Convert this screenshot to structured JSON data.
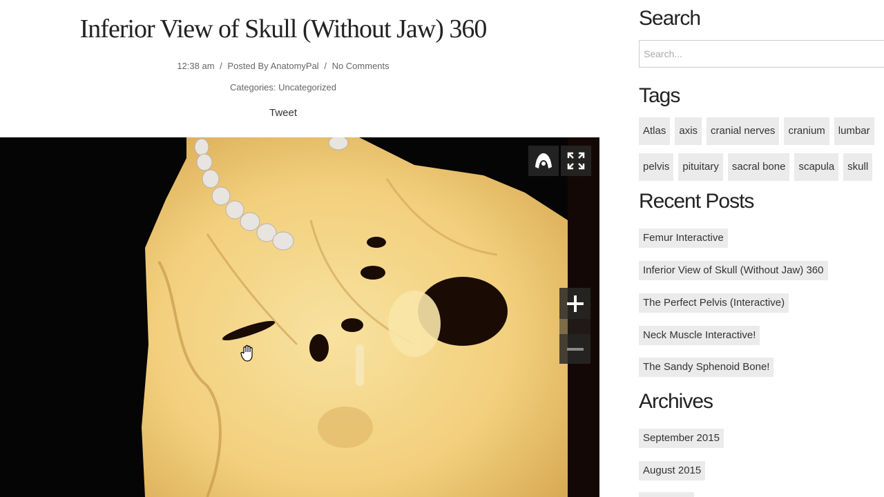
{
  "post": {
    "title": "Inferior View of Skull (Without Jaw) 360",
    "time": "12:38 am",
    "posted_by_prefix": "Posted By",
    "author": "AnatomyPal",
    "comments": "No Comments",
    "separator": "/",
    "categories_label": "Categories:",
    "category": "Uncategorized",
    "tweet_label": "Tweet"
  },
  "viewer": {
    "icons": {
      "gyro": "gyroscope-icon",
      "fullscreen": "fullscreen-icon",
      "zoom_in": "zoom-in-icon",
      "zoom_out": "zoom-out-icon",
      "cursor": "grab-hand-cursor-icon"
    }
  },
  "sidebar": {
    "search": {
      "title": "Search",
      "placeholder": "Search..."
    },
    "tags": {
      "title": "Tags",
      "row1": [
        "Atlas",
        "axis",
        "cranial nerves",
        "cranium",
        "lumbar"
      ],
      "row2": [
        "pelvis",
        "pituitary",
        "sacral bone",
        "scapula",
        "skull"
      ]
    },
    "recent_posts": {
      "title": "Recent Posts",
      "items": [
        "Femur Interactive",
        "Inferior View of Skull (Without Jaw) 360",
        "The Perfect Pelvis (Interactive)",
        "Neck Muscle Interactive!",
        "The Sandy Sphenoid Bone!"
      ]
    },
    "archives": {
      "title": "Archives",
      "items": [
        "September 2015",
        "August 2015"
      ]
    }
  },
  "colors": {
    "chip_bg": "#ebebeb",
    "bone": "#f4d68a",
    "viewer_bg": "#000000"
  }
}
